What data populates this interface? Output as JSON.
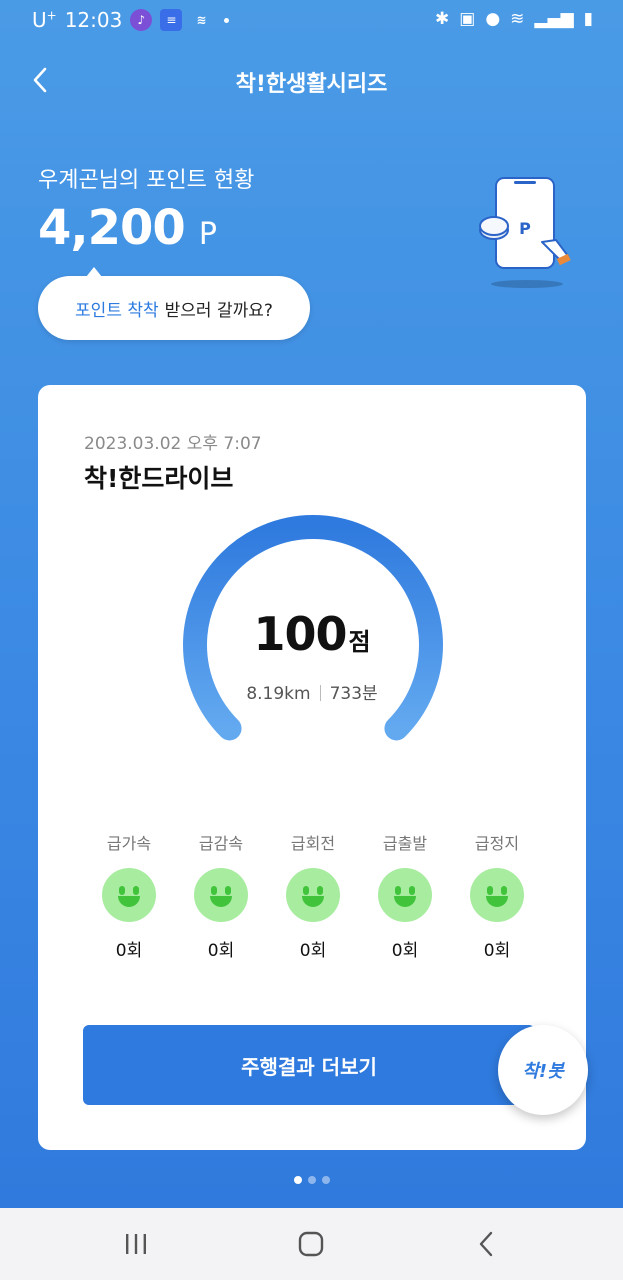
{
  "status_bar": {
    "carrier": "U",
    "carrier_sup": "+",
    "time": "12:03",
    "icons": [
      "bluetooth-icon",
      "battery-saver-icon",
      "location-icon",
      "wifi-icon",
      "signal-icon",
      "battery-icon"
    ]
  },
  "header": {
    "title": "착!한생활시리즈"
  },
  "points": {
    "label": "우계곤님의 포인트 현황",
    "value": "4,200",
    "unit": "P"
  },
  "bubble": {
    "highlight": "포인트 착착",
    "rest": "받으러 갈까요?"
  },
  "card": {
    "date": "2023.03.02 오후 7:07",
    "title": "착!한드라이브",
    "score": "100",
    "score_unit": "점",
    "distance": "8.19km",
    "duration": "733분",
    "gauge_fraction": 1.0,
    "events": [
      {
        "label": "급가속",
        "count": "0회"
      },
      {
        "label": "급감속",
        "count": "0회"
      },
      {
        "label": "급회전",
        "count": "0회"
      },
      {
        "label": "급출발",
        "count": "0회"
      },
      {
        "label": "급정지",
        "count": "0회"
      }
    ],
    "more_button": "주행결과 더보기",
    "bot_label": "착!봇"
  },
  "pager": {
    "count": 3,
    "active": 0
  },
  "colors": {
    "accent": "#2f7ade",
    "face": "#a8eca0",
    "face_feature": "#41c43c"
  }
}
